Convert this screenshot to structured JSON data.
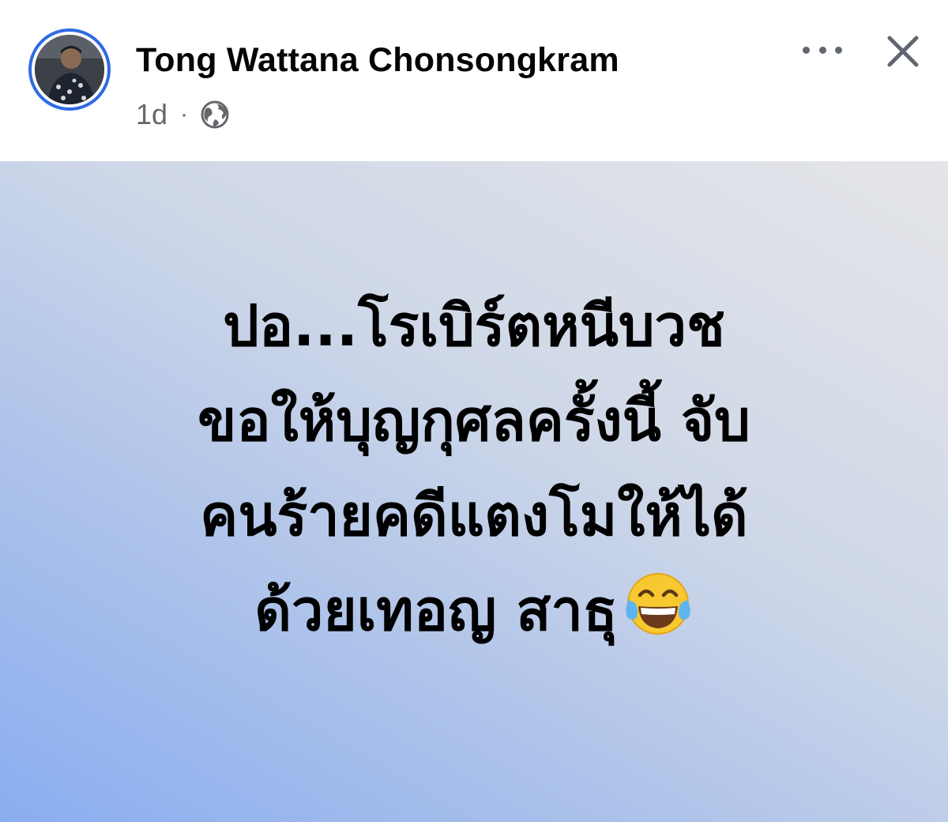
{
  "post": {
    "author": "Tong Wattana Chonsongkram",
    "time": "1d",
    "separator": "·",
    "privacy_icon": "globe-icon",
    "more_icon": "more-options-icon",
    "close_icon": "close-icon",
    "lines": [
      "ปอ...โรเบิร์ตหนีบวช",
      "ขอให้บุญกุศลครั้งนี้ จับ",
      "คนร้ายคดีแตงโมให้ได้",
      "ด้วยเทอญ สาธุ"
    ],
    "emoji": "face-with-tears-of-joy-emoji"
  },
  "colors": {
    "avatar_ring": "#2d6be4",
    "name": "#050505",
    "meta": "#65676b",
    "gradient_start": "#8aadf1",
    "gradient_end": "#e4e5e8"
  }
}
